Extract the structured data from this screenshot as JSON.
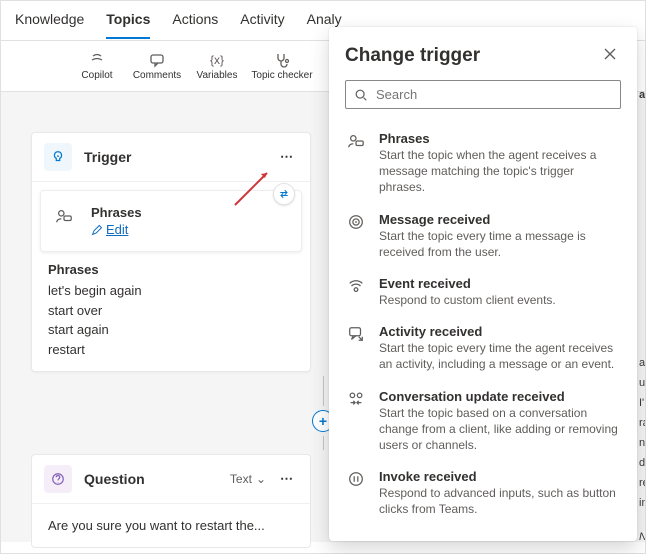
{
  "tabs": {
    "knowledge": "Knowledge",
    "topics": "Topics",
    "actions": "Actions",
    "activity": "Activity",
    "analytics": "Analy"
  },
  "toolbar": {
    "copilot": "Copilot",
    "comments": "Comments",
    "variables": "Variables",
    "topic_checker": "Topic checker"
  },
  "trigger_node": {
    "title": "Trigger",
    "body_title": "Phrases",
    "edit_label": "Edit",
    "phrases_heading": "Phrases",
    "phrases": [
      "let's begin again",
      "start over",
      "start again",
      "restart"
    ]
  },
  "question_node": {
    "title": "Question",
    "type_label": "Text",
    "body_text": "Are you sure you want to restart the..."
  },
  "popover": {
    "title": "Change trigger",
    "search_placeholder": "Search",
    "items": [
      {
        "icon": "person-chat",
        "title": "Phrases",
        "desc": "Start the topic when the agent receives a message matching the topic's trigger phrases."
      },
      {
        "icon": "target",
        "title": "Message received",
        "desc": "Start the topic every time a message is received from the user."
      },
      {
        "icon": "wave",
        "title": "Event received",
        "desc": "Respond to custom client events."
      },
      {
        "icon": "chat-arrow",
        "title": "Activity received",
        "desc": "Start the topic every time the agent receives an activity, including a message or an event."
      },
      {
        "icon": "people-swap",
        "title": "Conversation update received",
        "desc": "Start the topic based on a conversation change from a client, like adding or removing users or channels."
      },
      {
        "icon": "pause",
        "title": "Invoke received",
        "desc": "Respond to advanced inputs, such as button clicks from Teams."
      }
    ]
  },
  "icons": {
    "search": "search-icon",
    "close": "close-icon"
  },
  "sidebar_bleed": {
    "l1": "ag",
    "l2": "a",
    "l3": "u",
    "l4": "I'",
    "l5": "ra",
    "l6": "na",
    "l7": "documents, V",
    "l8": "regulations, c",
    "l9": "insurance op",
    "l10": "Note: You ca"
  }
}
